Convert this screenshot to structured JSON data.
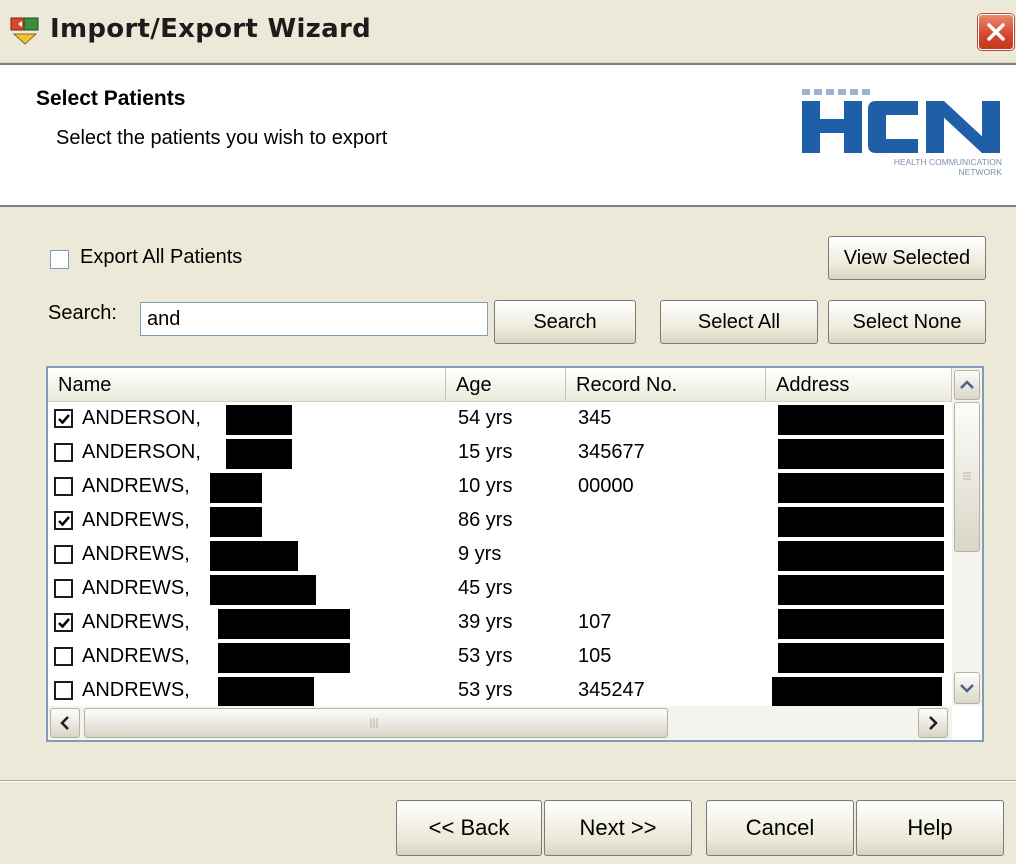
{
  "window": {
    "title": "Import/Export Wizard",
    "close_label": "X"
  },
  "header": {
    "title": "Select Patients",
    "subtitle": "Select the patients you wish to export",
    "logo_text": "HCN",
    "logo_tagline_1": "HEALTH COMMUNICATION",
    "logo_tagline_2": "NETWORK"
  },
  "controls": {
    "export_all_label": "Export All Patients",
    "export_all_checked": false,
    "view_selected_label": "View Selected",
    "search_label": "Search:",
    "search_value": "and",
    "search_button": "Search",
    "select_all_button": "Select All",
    "select_none_button": "Select None"
  },
  "table": {
    "columns": [
      "Name",
      "Age",
      "Record No.",
      "Address"
    ],
    "rows": [
      {
        "checked": true,
        "name": "ANDERSON,",
        "age": "54 yrs",
        "record": "345"
      },
      {
        "checked": false,
        "name": "ANDERSON,",
        "age": "15 yrs",
        "record": "345677"
      },
      {
        "checked": false,
        "name": "ANDREWS,",
        "age": "10 yrs",
        "record": "00000"
      },
      {
        "checked": true,
        "name": "ANDREWS,",
        "age": "86 yrs",
        "record": ""
      },
      {
        "checked": false,
        "name": "ANDREWS,",
        "age": "9 yrs",
        "record": ""
      },
      {
        "checked": false,
        "name": "ANDREWS,",
        "age": "45 yrs",
        "record": ""
      },
      {
        "checked": true,
        "name": "ANDREWS,",
        "age": "39 yrs",
        "record": "107"
      },
      {
        "checked": false,
        "name": "ANDREWS,",
        "age": "53 yrs",
        "record": "105"
      },
      {
        "checked": false,
        "name": "ANDREWS,",
        "age": "53 yrs",
        "record": "345247"
      }
    ]
  },
  "footer": {
    "back_label": "<< Back",
    "next_label": "Next >>",
    "cancel_label": "Cancel",
    "help_label": "Help"
  },
  "colors": {
    "logo_blue": "#1f5fa8",
    "close_red": "#d4452a",
    "face": "#ECE9D8",
    "border_blue": "#7f9db9"
  },
  "icons": [
    "wizard-app-icon",
    "close-icon",
    "checkbox-icon",
    "scroll-up-icon",
    "scroll-down-icon",
    "scroll-left-icon",
    "scroll-right-icon"
  ]
}
